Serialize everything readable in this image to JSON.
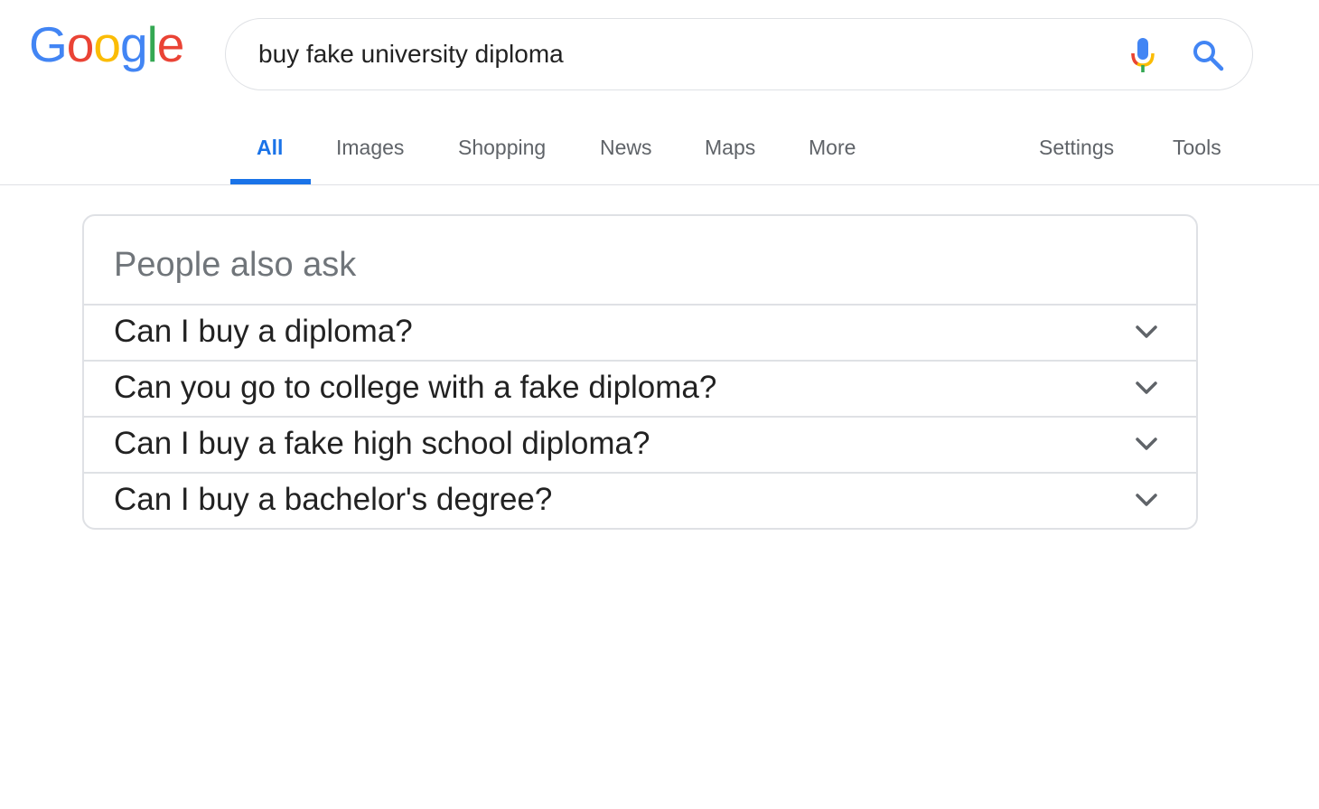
{
  "logo": {
    "letters": [
      "G",
      "o",
      "o",
      "g",
      "l",
      "e"
    ],
    "colors": [
      "#4285F4",
      "#EA4335",
      "#FBBC05",
      "#4285F4",
      "#34A853",
      "#EA4335"
    ]
  },
  "search": {
    "query": "buy fake university diploma",
    "mic_icon": "microphone-icon",
    "search_icon": "magnifier-icon"
  },
  "tabs": {
    "all": "All",
    "images": "Images",
    "shopping": "Shopping",
    "news": "News",
    "maps": "Maps",
    "more": "More",
    "settings": "Settings",
    "tools": "Tools",
    "active": "All",
    "accent_color": "#1a73e8"
  },
  "people_also_ask": {
    "title": "People also ask",
    "questions": [
      "Can I buy a diploma?",
      "Can you go to college with a fake diploma?",
      "Can I buy a fake high school diploma?",
      "Can I buy a bachelor's degree?"
    ],
    "expand_icon": "chevron-down-icon"
  }
}
